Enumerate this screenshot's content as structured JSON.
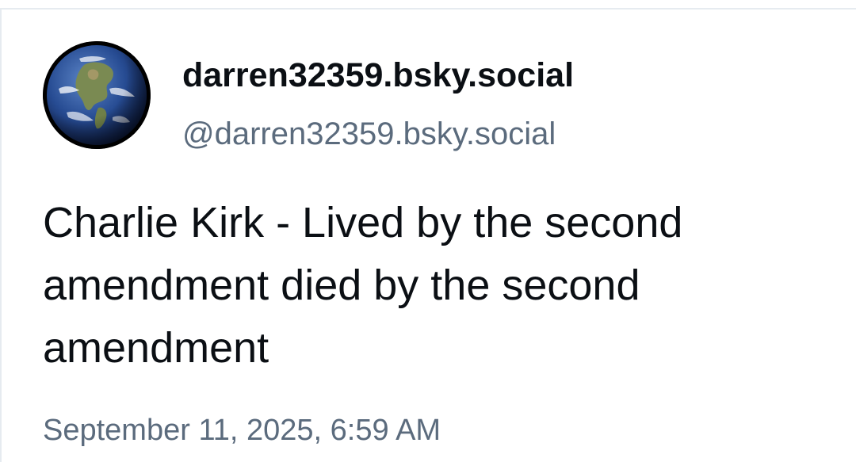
{
  "post": {
    "display_name": "darren32359.bsky.social",
    "handle": "@darren32359.bsky.social",
    "text": "Charlie Kirk - Lived by the second amendment died by the second amendment",
    "timestamp": "September 11, 2025, 6:59 AM",
    "avatar_icon": "earth-globe-icon"
  },
  "colors": {
    "text_primary": "#0b0f14",
    "text_secondary": "#5b6b7d",
    "border": "#e6ebf0",
    "background": "#ffffff"
  }
}
